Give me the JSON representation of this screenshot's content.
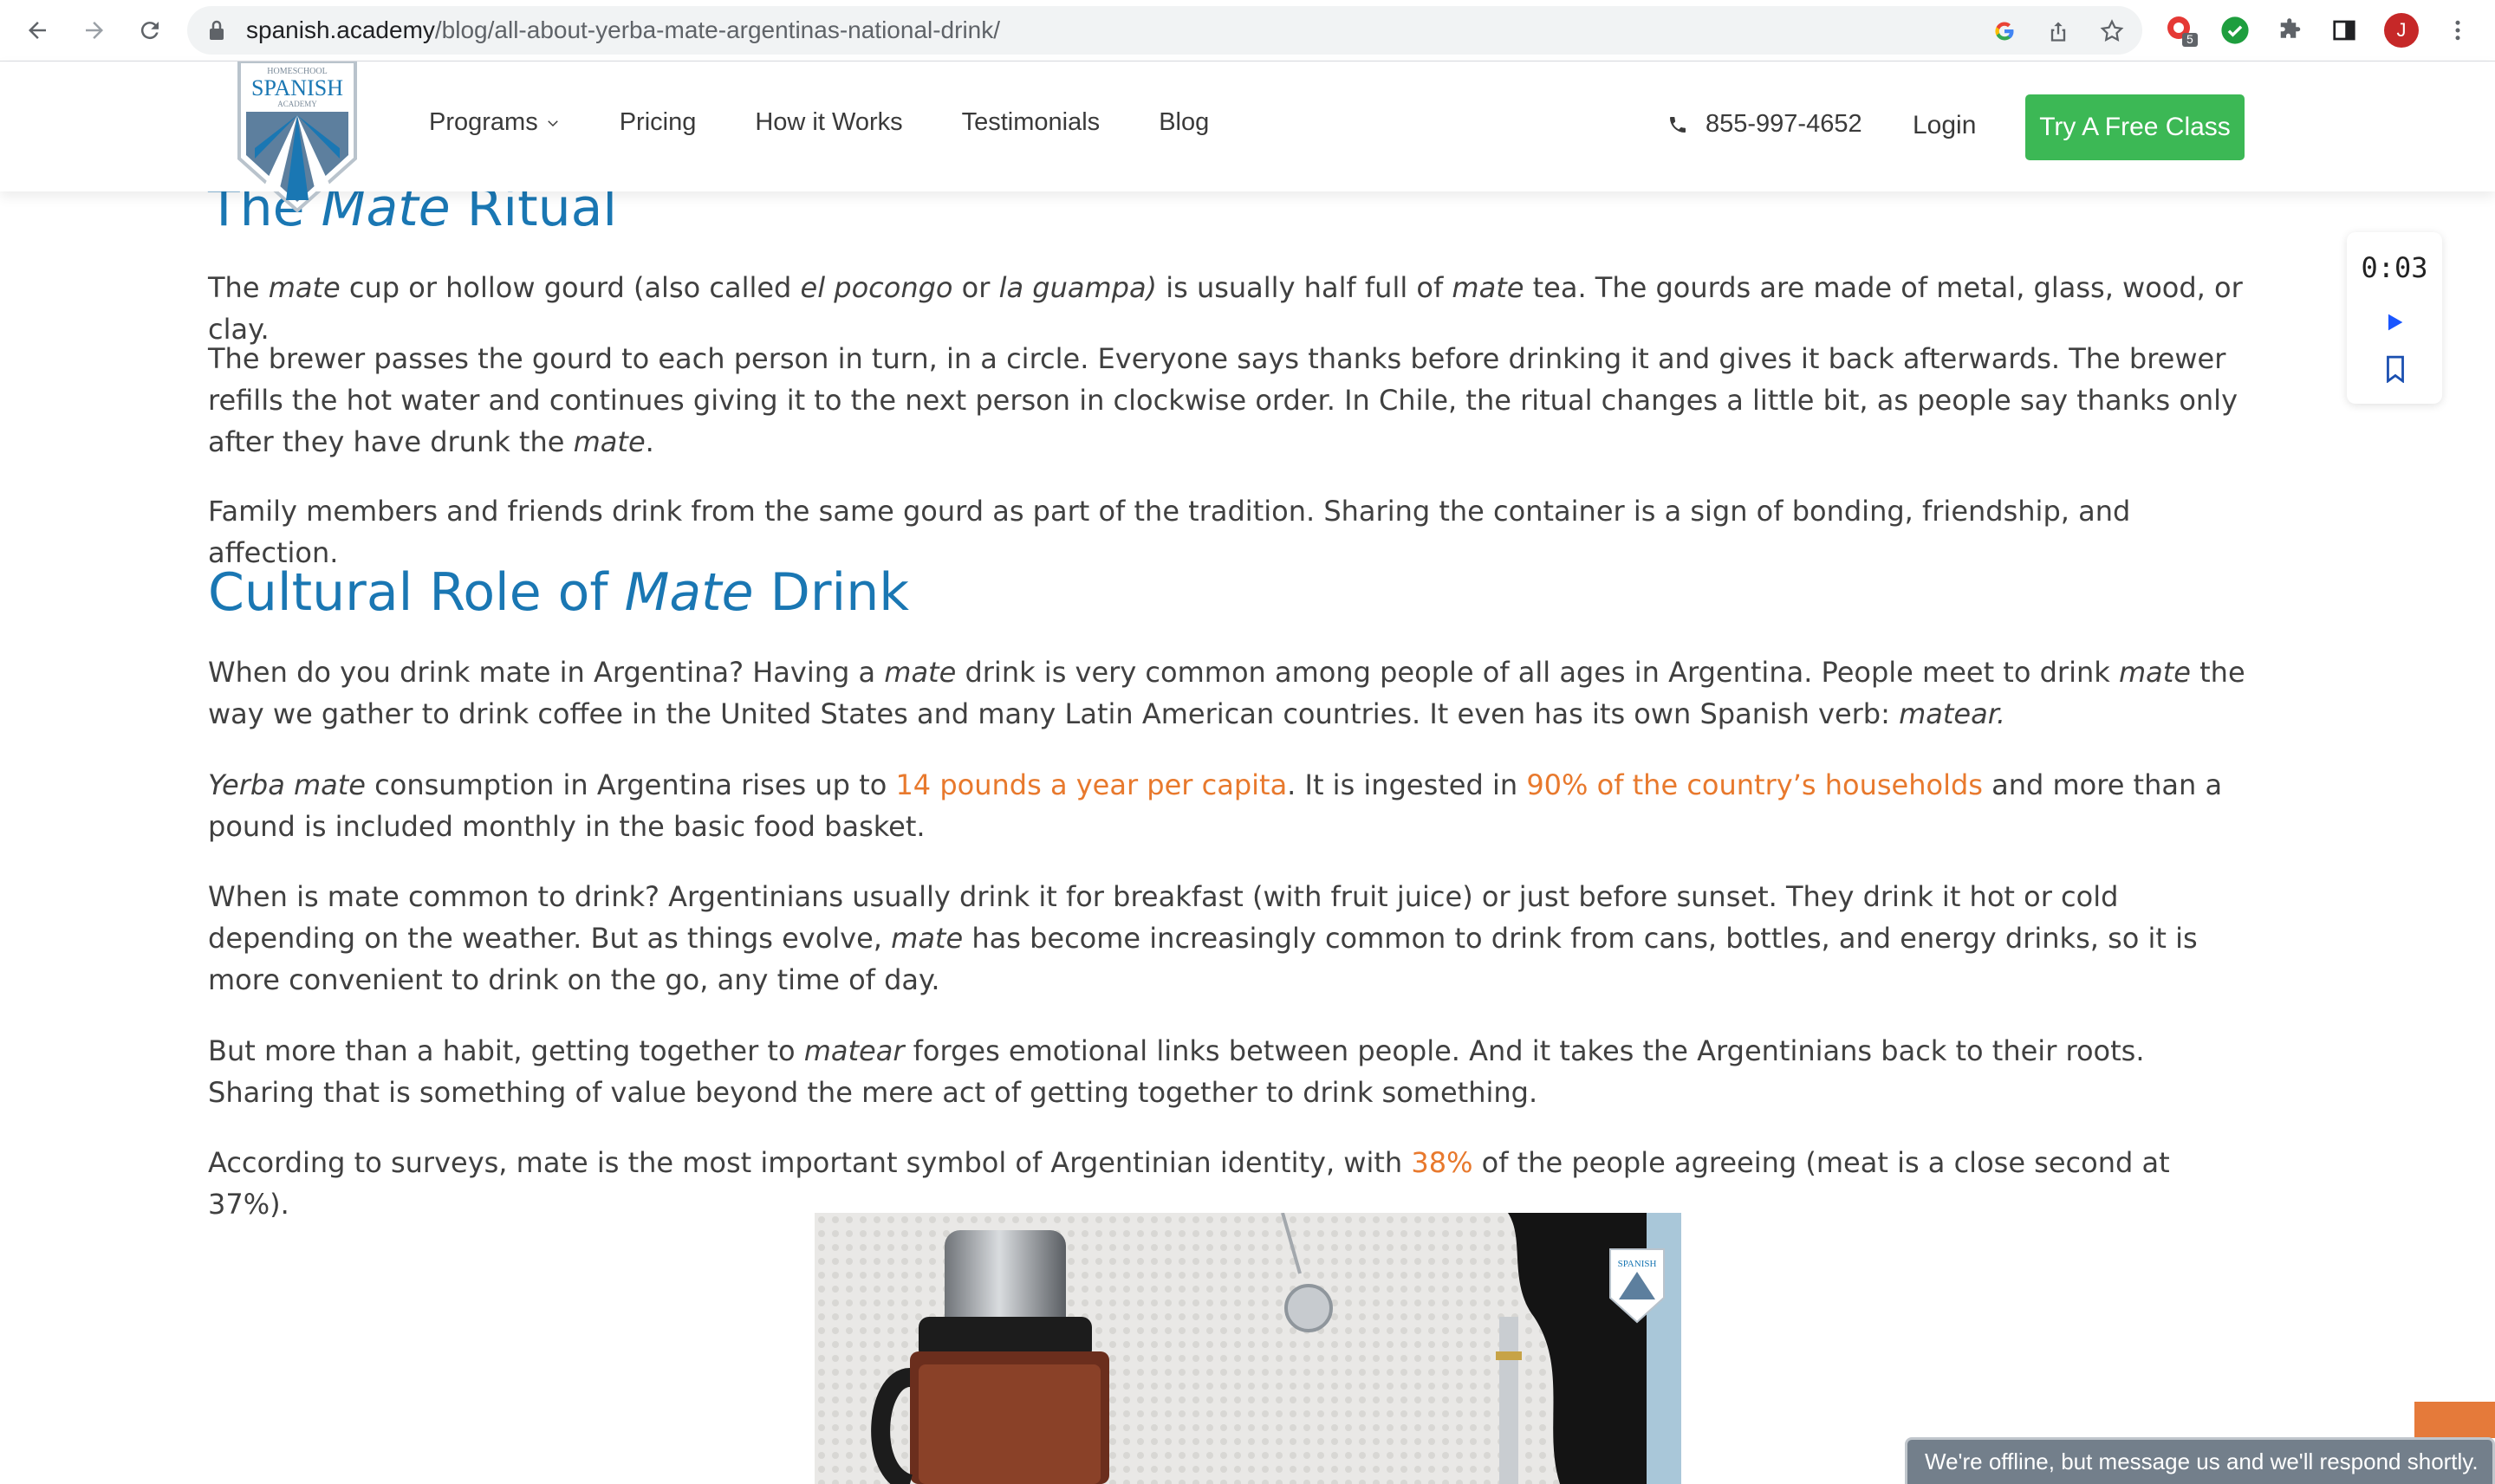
{
  "browser": {
    "url_host": "spanish.academy",
    "url_path": "/blog/all-about-yerba-mate-argentinas-national-drink/",
    "profile_initial": "J",
    "extension_badge": "5"
  },
  "header": {
    "logo_text_top": "HOMESCHOOL",
    "logo_text_main": "SPANISH",
    "logo_text_bottom": "ACADEMY",
    "menu": [
      {
        "label": "Programs"
      },
      {
        "label": "Pricing"
      },
      {
        "label": "How it Works"
      },
      {
        "label": "Testimonials"
      },
      {
        "label": "Blog"
      }
    ],
    "phone": "855-997-4652",
    "login": "Login",
    "cta": "Try A Free Class"
  },
  "article": {
    "h1_a": "The ",
    "h1_b": "Mate",
    "h1_c": " Ritual",
    "p1": [
      "The ",
      "mate",
      " cup or hollow gourd (also called ",
      "el pocongo",
      " or ",
      "la guampa)",
      " is usually half full of ",
      "mate",
      " tea. The gourds are made of metal, glass, wood, or clay."
    ],
    "p2": [
      "The brewer passes the gourd to each person in turn, in a circle. Everyone says thanks before drinking it and gives it back afterwards. The brewer refills the hot water and continues giving it to the next person in clockwise order. In Chile, the ritual changes a little bit, as people say thanks only after they have drunk the ",
      "mate",
      "."
    ],
    "p3": "Family members and friends drink from the same gourd as part of the tradition. Sharing the container is a sign of bonding, friendship, and affection.",
    "h2_a": "Cultural Role of ",
    "h2_b": "Mate",
    "h2_c": " Drink",
    "p4": [
      "When do you drink mate in Argentina? Having a ",
      "mate",
      " drink is very common among people of all ages in Argentina. People meet to drink ",
      "mate",
      " the way we gather to drink coffee in the United States and many Latin American countries. It even has its own Spanish verb: ",
      "matear."
    ],
    "p5": [
      "Yerba mate",
      " consumption in Argentina rises up to ",
      "14 pounds a year per capita",
      ". It is ingested in ",
      "90% of the country’s households",
      " and more than a pound is included monthly in the basic food basket."
    ],
    "p6": [
      "When is mate common to drink? Argentinians usually drink it for breakfast (with fruit juice) or just before sunset. They drink it hot or cold depending on the weather. But as things evolve, ",
      "mate",
      " has become increasingly common to drink from cans, bottles, and energy drinks, so it is more convenient to drink on the go, any time of day."
    ],
    "p7": [
      "But more than a habit, getting together to ",
      "matear",
      " forges emotional links between people. And it takes the Argentinians back to their roots. Sharing that is something of value beyond the mere act of getting together to drink something."
    ],
    "p8": [
      "According to surveys, mate is the most important symbol of Argentinian identity, with ",
      "38%",
      " of the people agreeing (meat is a close second at 37%)."
    ],
    "photo_logo_text": "SPANISH"
  },
  "audio": {
    "time": "0:03"
  },
  "chat": {
    "message": "We're offline, but message us and we'll respond shortly."
  },
  "colors": {
    "heading": "#1a77b3",
    "link": "#e8792d",
    "cta": "#3cb855"
  }
}
